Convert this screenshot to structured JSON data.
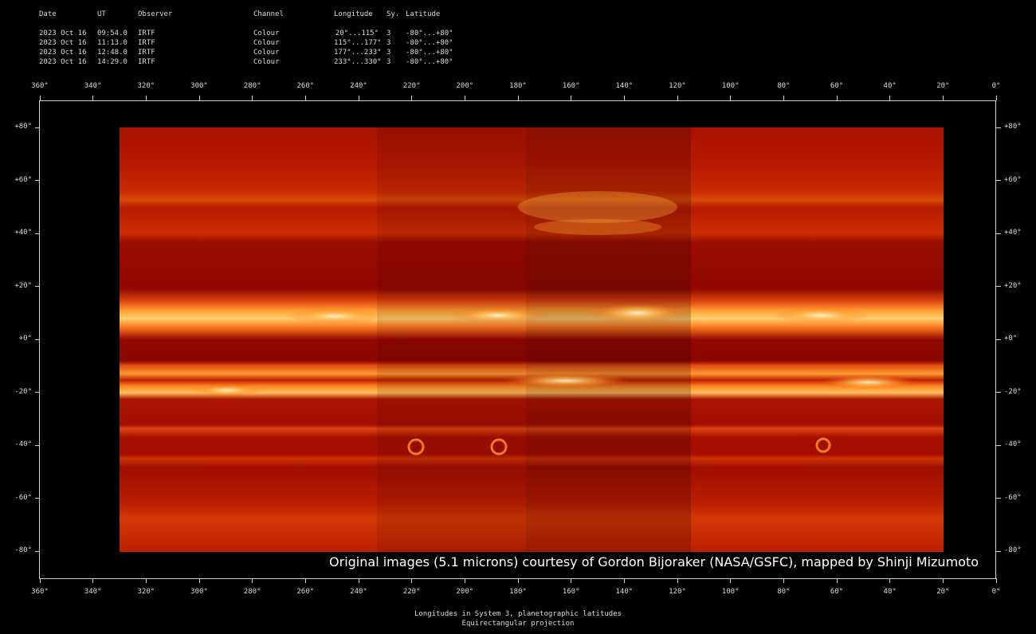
{
  "table": {
    "headers": {
      "date": "Date",
      "ut": "UT",
      "observer": "Observer",
      "channel": "Channel",
      "longitude": "Longitude",
      "sy": "Sy.",
      "latitude": "Latitude"
    },
    "rows": [
      {
        "date": "2023 Oct 16",
        "ut": "09:54.0",
        "observer": "IRTF",
        "channel": "Colour",
        "longitude": "20°...115°",
        "sy": "3",
        "latitude": "-80°...+80°"
      },
      {
        "date": "2023 Oct 16",
        "ut": "11:13.0",
        "observer": "IRTF",
        "channel": "Colour",
        "longitude": "115°...177°",
        "sy": "3",
        "latitude": "-80°...+80°"
      },
      {
        "date": "2023 Oct 16",
        "ut": "12:48.0",
        "observer": "IRTF",
        "channel": "Colour",
        "longitude": "177°...233°",
        "sy": "3",
        "latitude": "-80°...+80°"
      },
      {
        "date": "2023 Oct 16",
        "ut": "14:29.0",
        "observer": "IRTF",
        "channel": "Colour",
        "longitude": "233°...330°",
        "sy": "3",
        "latitude": "-80°...+80°"
      }
    ]
  },
  "axes": {
    "longitude_labels": [
      "360°",
      "340°",
      "320°",
      "300°",
      "280°",
      "260°",
      "240°",
      "220°",
      "200°",
      "180°",
      "160°",
      "140°",
      "120°",
      "100°",
      "80°",
      "60°",
      "40°",
      "20°",
      "0°"
    ],
    "latitude_labels": [
      "+80°",
      "+60°",
      "+40°",
      "+20°",
      "+0°",
      "-20°",
      "-40°",
      "-60°",
      "-80°"
    ]
  },
  "credit": "Original images (5.1 microns) courtesy of Gordon Bijoraker (NASA/GSFC), mapped by Shinji Mizumoto",
  "footer": {
    "line1": "Longitudes in System 3, planetographic latitudes",
    "line2": "Equirectangular projection"
  },
  "colors": {
    "background": "#000000",
    "map_dark": "#7a0000",
    "map_mid": "#c01800",
    "map_bright": "#ff8a20",
    "map_hot": "#fff4c0"
  }
}
